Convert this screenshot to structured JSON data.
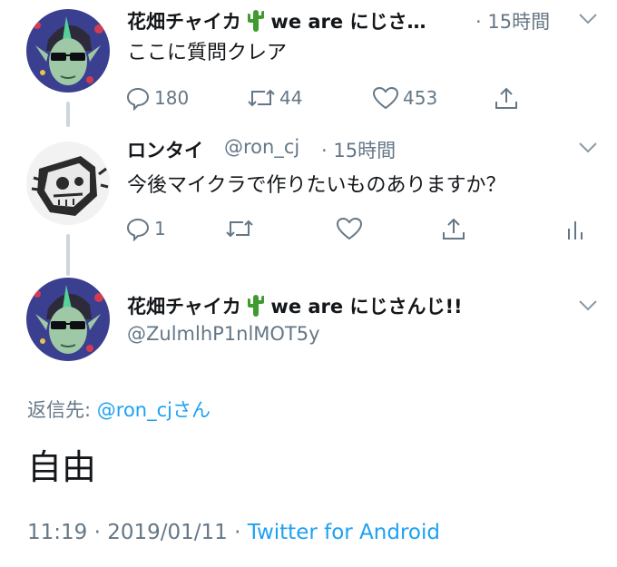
{
  "tweets": [
    {
      "name": "花畑チャイカ",
      "name_suffix": "we are にじさ…",
      "time": "· 15時間",
      "text": "ここに質問クレア",
      "actions": {
        "reply_count": "180",
        "retweet_count": "44",
        "like_count": "453"
      }
    },
    {
      "name": "ロンタイ",
      "handle": "@ron_cj",
      "time": "· 15時間",
      "text": "今後マイクラで作りたいものありますか？",
      "actions": {
        "reply_count": "1"
      }
    }
  ],
  "main_tweet": {
    "name": "花畑チャイカ",
    "name_suffix": "we are にじさんじ!!",
    "handle": "@ZulmlhP1nlMOT5y",
    "reply_to_label": "返信先:",
    "reply_to_handle": "@ron_cjさん",
    "text": "自由",
    "timestamp": "11:19 · 2019/01/11 ·",
    "source": "Twitter for Android"
  },
  "colors": {
    "accent": "#1da1f2",
    "secondary_text": "#657786",
    "primary_text": "#14171a",
    "thread_line": "#ccd6dd"
  },
  "icons": {
    "emoji": "cactus-emoji",
    "reply": "reply-icon",
    "retweet": "retweet-icon",
    "like": "heart-icon",
    "share": "share-icon",
    "analytics": "analytics-icon",
    "more": "chevron-down-icon"
  }
}
